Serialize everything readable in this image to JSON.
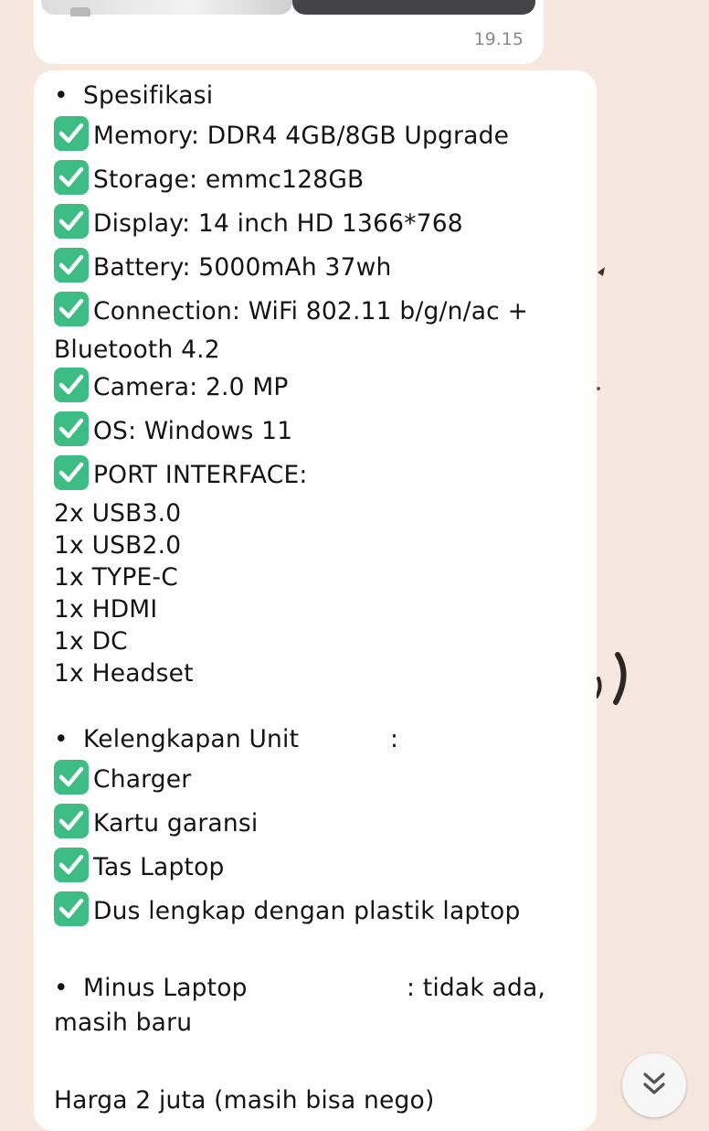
{
  "top_message": {
    "time": "19.15"
  },
  "message": {
    "spec_heading": "Spesifikasi",
    "specs": [
      "Memory: DDR4 4GB/8GB Upgrade",
      "Storage: emmc128GB",
      "Display: 14 inch HD 1366*768",
      "Battery: 5000mAh 37wh",
      "Connection: WiFi 802.11 b/g/n/ac +",
      "Bluetooth 4.2",
      "Camera: 2.0 MP",
      "OS: Windows 11",
      "PORT INTERFACE:"
    ],
    "ports": [
      "2x USB3.0",
      "1x USB2.0",
      "1x TYPE-C",
      "1x HDMI",
      "1x DC",
      "1x Headset"
    ],
    "kelengkapan_label": "Kelengkapan Unit",
    "kelengkapan_colon": ":",
    "kelengkapan": [
      "Charger",
      "Kartu garansi",
      "Tas Laptop",
      "Dus lengkap dengan plastik laptop"
    ],
    "minus_label": "Minus Laptop",
    "minus_value": ": tidak ada,",
    "minus_value_cont": "masih baru",
    "harga": "Harga 2 juta (masih bisa nego)"
  },
  "icons": {
    "check": "check-mark-button-icon",
    "scroll": "double-chevron-down-icon"
  },
  "colors": {
    "background": "#f6e8de",
    "bubble": "#ffffff",
    "check_green": "#3dbd84"
  }
}
